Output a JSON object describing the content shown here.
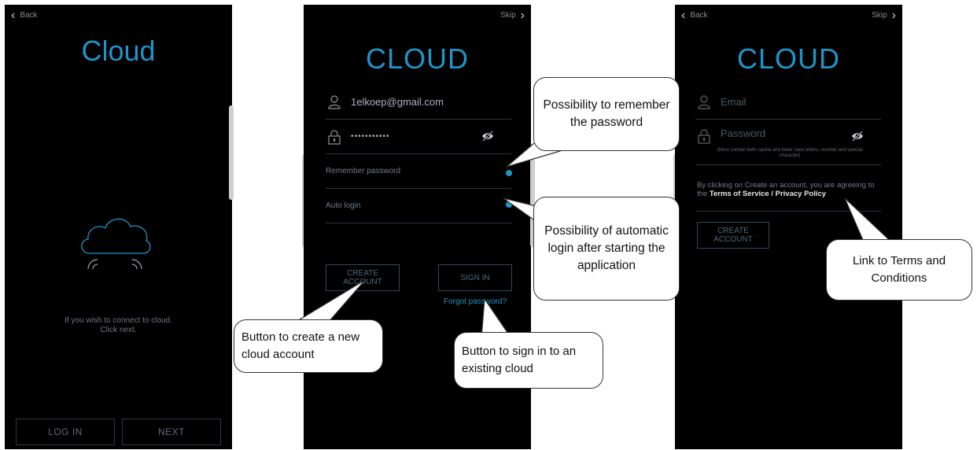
{
  "screen1": {
    "back_label": "Back",
    "title": "Cloud",
    "message_line1": "If you wish to connect to cloud.",
    "message_line2": "Click next.",
    "login_label": "LOG IN",
    "next_label": "NEXT"
  },
  "screen2": {
    "skip_label": "Skip",
    "title": "CLOUD",
    "email_value": "1elkoep@gmail.com",
    "password_value": "•••••••••••",
    "remember_label": "Remember password",
    "autologin_label": "Auto login",
    "create_line1": "CREATE",
    "create_line2": "ACCOUNT",
    "signin_label": "SIGN IN",
    "forgot_label": "Forgot password?"
  },
  "screen3": {
    "back_label": "Back",
    "skip_label": "Skip",
    "title": "CLOUD",
    "email_placeholder": "Email",
    "password_placeholder": "Password",
    "password_hint": "(Must contain both capital and lower case letters, number and special character)",
    "terms_text": "By clicking on Create an account, you are agreeing to the",
    "terms_link": "Terms of Service / Privacy Policy",
    "create_line1": "CREATE",
    "create_line2": "ACCOUNT"
  },
  "callouts": {
    "remember": "Possibility to remember the password",
    "autologin": "Possibility of automatic login after starting the application",
    "create": "Button to create a new cloud account",
    "signin": "Button to sign in to an existing cloud",
    "terms": "Link to Terms and Conditions"
  },
  "colors": {
    "accent": "#1f94c8",
    "background": "#000000"
  }
}
